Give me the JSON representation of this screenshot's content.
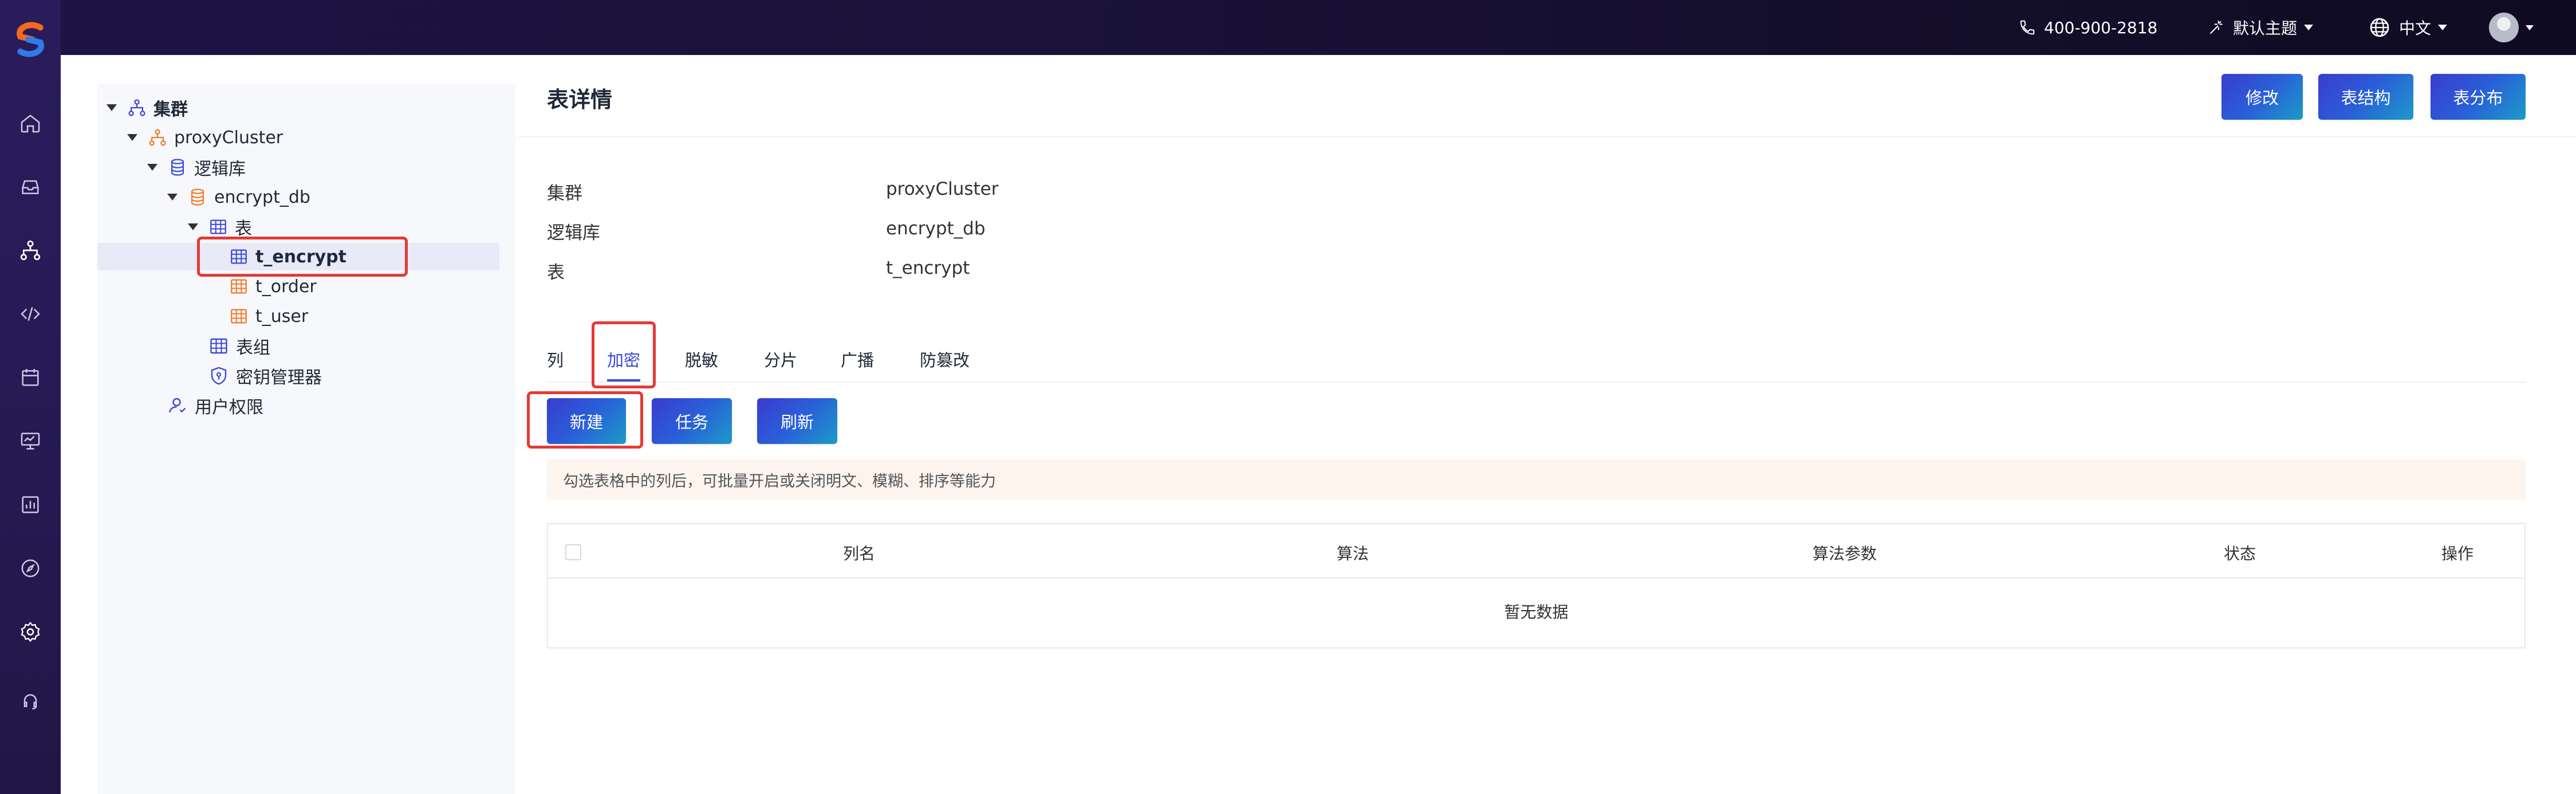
{
  "header": {
    "phone": "400-900-2818",
    "theme": "默认主题",
    "language": "中文"
  },
  "sidebar_nav": {
    "icons": [
      "home-icon",
      "inbox-icon",
      "cluster-icon",
      "code-icon",
      "calendar-icon",
      "monitor-icon",
      "report-icon",
      "compass-icon",
      "settings-icon",
      "headset-icon"
    ]
  },
  "tree": {
    "cluster": "集群",
    "proxy_cluster": "proxyCluster",
    "logic_db": "逻辑库",
    "encrypt_db": "encrypt_db",
    "tables": "表",
    "t_encrypt": "t_encrypt",
    "t_order": "t_order",
    "t_user": "t_user",
    "table_group": "表组",
    "key_manager": "密钥管理器",
    "user_perm": "用户权限"
  },
  "main": {
    "title": "表详情",
    "buttons": {
      "edit": "修改",
      "structure": "表结构",
      "distribution": "表分布"
    },
    "info": {
      "cluster_label": "集群",
      "cluster_value": "proxyCluster",
      "db_label": "逻辑库",
      "db_value": "encrypt_db",
      "table_label": "表",
      "table_value": "t_encrypt"
    },
    "tabs": [
      "列",
      "加密",
      "脱敏",
      "分片",
      "广播",
      "防篡改"
    ],
    "active_tab": "加密",
    "actions": {
      "new": "新建",
      "task": "任务",
      "refresh": "刷新"
    },
    "hint": "勾选表格中的列后，可批量开启或关闭明文、模糊、排序等能力",
    "table": {
      "columns": [
        "列名",
        "算法",
        "算法参数",
        "状态",
        "操作"
      ],
      "empty": "暂无数据"
    }
  },
  "colors": {
    "accent": "#3b49d6",
    "highlight": "#e53935",
    "topbar": "#1e1346"
  }
}
